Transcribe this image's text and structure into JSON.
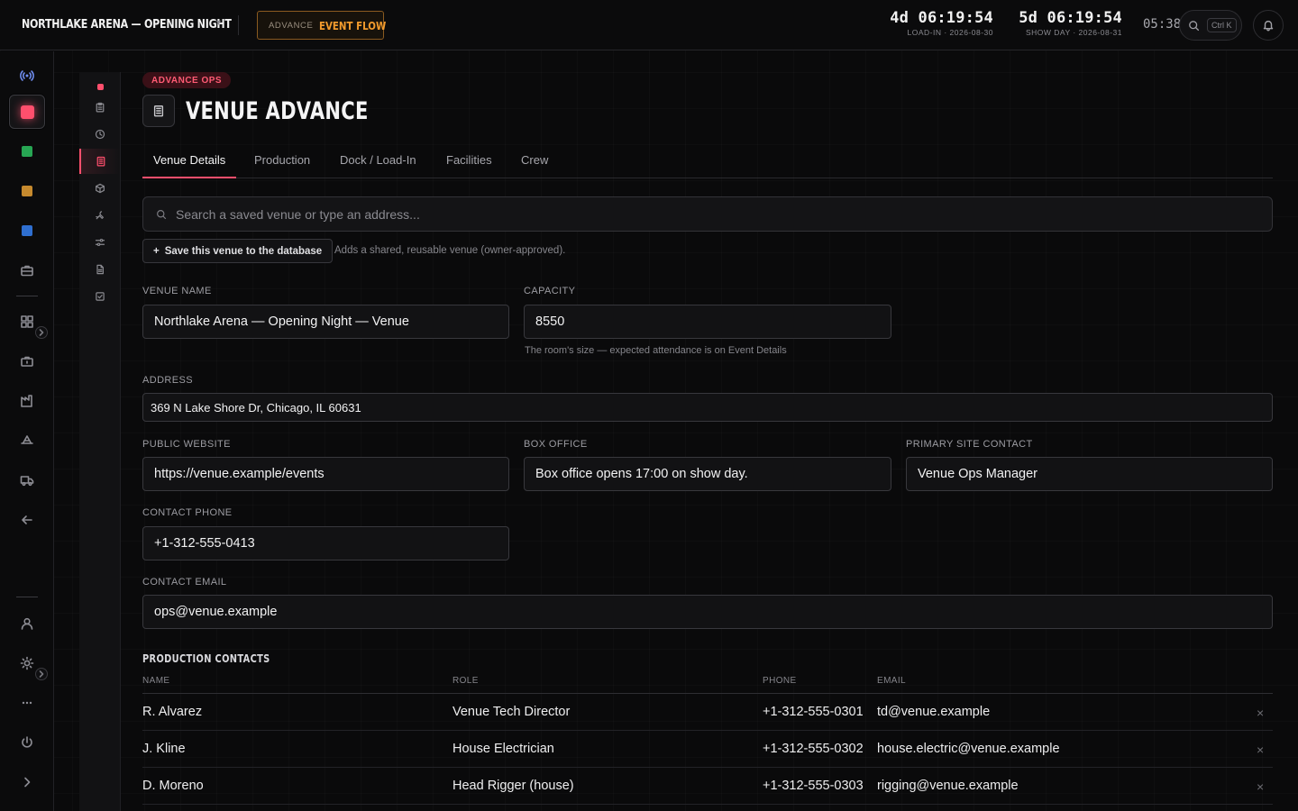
{
  "header": {
    "event_title": "NORTHLAKE ARENA — OPENING NIGHT",
    "flow_small": "ADVANCE",
    "flow_big": "EVENT FLOW",
    "countdowns": [
      {
        "time": "4d 06:19:54",
        "label": "LOAD-IN · 2026-08-30"
      },
      {
        "time": "5d 06:19:54",
        "label": "SHOW DAY · 2026-08-31"
      }
    ],
    "clock": "05:38",
    "search_kbd": "Ctrl K"
  },
  "rail": {
    "items": [
      "broadcast-icon",
      "active-square",
      "green-square",
      "amber-square",
      "blue-square",
      "briefcase-icon",
      "grid-icon",
      "suitcase-icon",
      "factory-icon",
      "stage-icon",
      "truck-icon",
      "back-arrow-icon",
      "user-icon",
      "sun-icon",
      "more-icon",
      "power-icon",
      "expand-icon"
    ],
    "colors": {
      "active": "#ff4f6d",
      "green": "#27a653",
      "amber": "#c68a2e",
      "blue": "#2f6fd0"
    }
  },
  "subrail": {
    "items": [
      "dot",
      "clipboard-icon",
      "clock-icon",
      "building-icon",
      "box-icon",
      "wrench-icon",
      "sliders-icon",
      "document-icon",
      "check-icon"
    ],
    "active_index": 3
  },
  "page": {
    "section_tag": "ADVANCE OPS",
    "title": "VENUE ADVANCE",
    "tabs": [
      "Venue Details",
      "Production",
      "Dock / Load-In",
      "Facilities",
      "Crew"
    ],
    "active_tab": 0,
    "accent": "#ff4f6d"
  },
  "venue_search": {
    "placeholder": "Search a saved venue or type an address...",
    "save_label": "Save this venue to the database",
    "save_hint": "Adds a shared, reusable venue (owner-approved)."
  },
  "fields": {
    "venue_name": {
      "label": "VENUE NAME",
      "value": "Northlake Arena — Opening Night — Venue"
    },
    "capacity": {
      "label": "CAPACITY",
      "value": "8550",
      "help": "The room's size — expected attendance is on Event Details"
    },
    "address": {
      "label": "ADDRESS",
      "value": "369 N Lake Shore Dr, Chicago, IL 60631"
    },
    "website": {
      "label": "PUBLIC WEBSITE",
      "value": "https://venue.example/events"
    },
    "box_office": {
      "label": "BOX OFFICE",
      "value": "Box office opens 17:00 on show day."
    },
    "site_contact": {
      "label": "PRIMARY SITE CONTACT",
      "value": "Venue Ops Manager"
    },
    "phone": {
      "label": "CONTACT PHONE",
      "value": "+1-312-555-0413"
    },
    "email": {
      "label": "CONTACT EMAIL",
      "value": "ops@venue.example"
    }
  },
  "production_contacts": {
    "title": "PRODUCTION CONTACTS",
    "columns": [
      "NAME",
      "ROLE",
      "PHONE",
      "EMAIL"
    ],
    "remove_symbol": "×",
    "rows": [
      {
        "name": "R. Alvarez",
        "role": "Venue Tech Director",
        "phone": "+1-312-555-0301",
        "email": "td@venue.example"
      },
      {
        "name": "J. Kline",
        "role": "House Electrician",
        "phone": "+1-312-555-0302",
        "email": "house.electric@venue.example"
      },
      {
        "name": "D. Moreno",
        "role": "Head Rigger (house)",
        "phone": "+1-312-555-0303",
        "email": "rigging@venue.example"
      }
    ]
  }
}
